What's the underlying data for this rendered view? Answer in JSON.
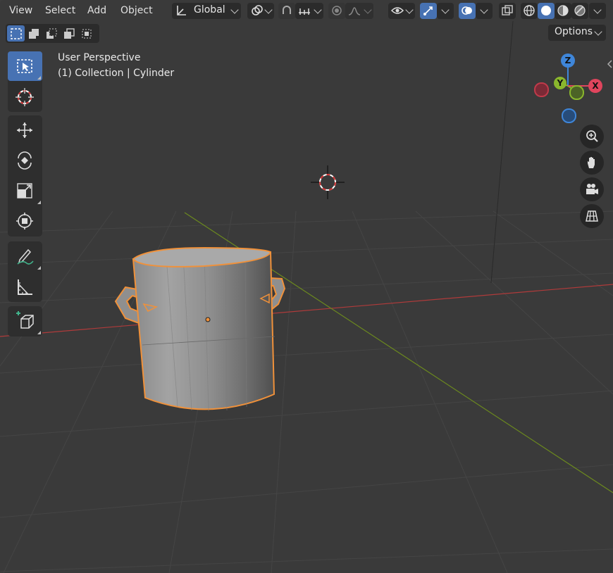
{
  "menu": {
    "view": "View",
    "select": "Select",
    "add": "Add",
    "object": "Object"
  },
  "header": {
    "orientation_label": "Global",
    "options_label": "Options"
  },
  "viewport": {
    "perspective_label": "User Perspective",
    "collection_label": "(1) Collection | Cylinder"
  },
  "gizmo": {
    "z_label": "Z",
    "y_label": "Y",
    "x_label": "X",
    "colors": {
      "x": "#e0455d",
      "y": "#8ab72d",
      "z": "#3f86d9"
    }
  },
  "toolbar": {
    "tools": [
      "select-box-tool",
      "cursor-tool",
      "move-tool",
      "rotate-tool",
      "scale-tool",
      "transform-tool",
      "annotate-tool",
      "measure-tool",
      "add-cube-tool"
    ],
    "active_tool": "select-box-tool"
  },
  "colors": {
    "accent": "#4772b3",
    "selection_outline": "#f0913a",
    "x_axis": "#b03a3a",
    "y_axis": "#6c8a1e"
  }
}
